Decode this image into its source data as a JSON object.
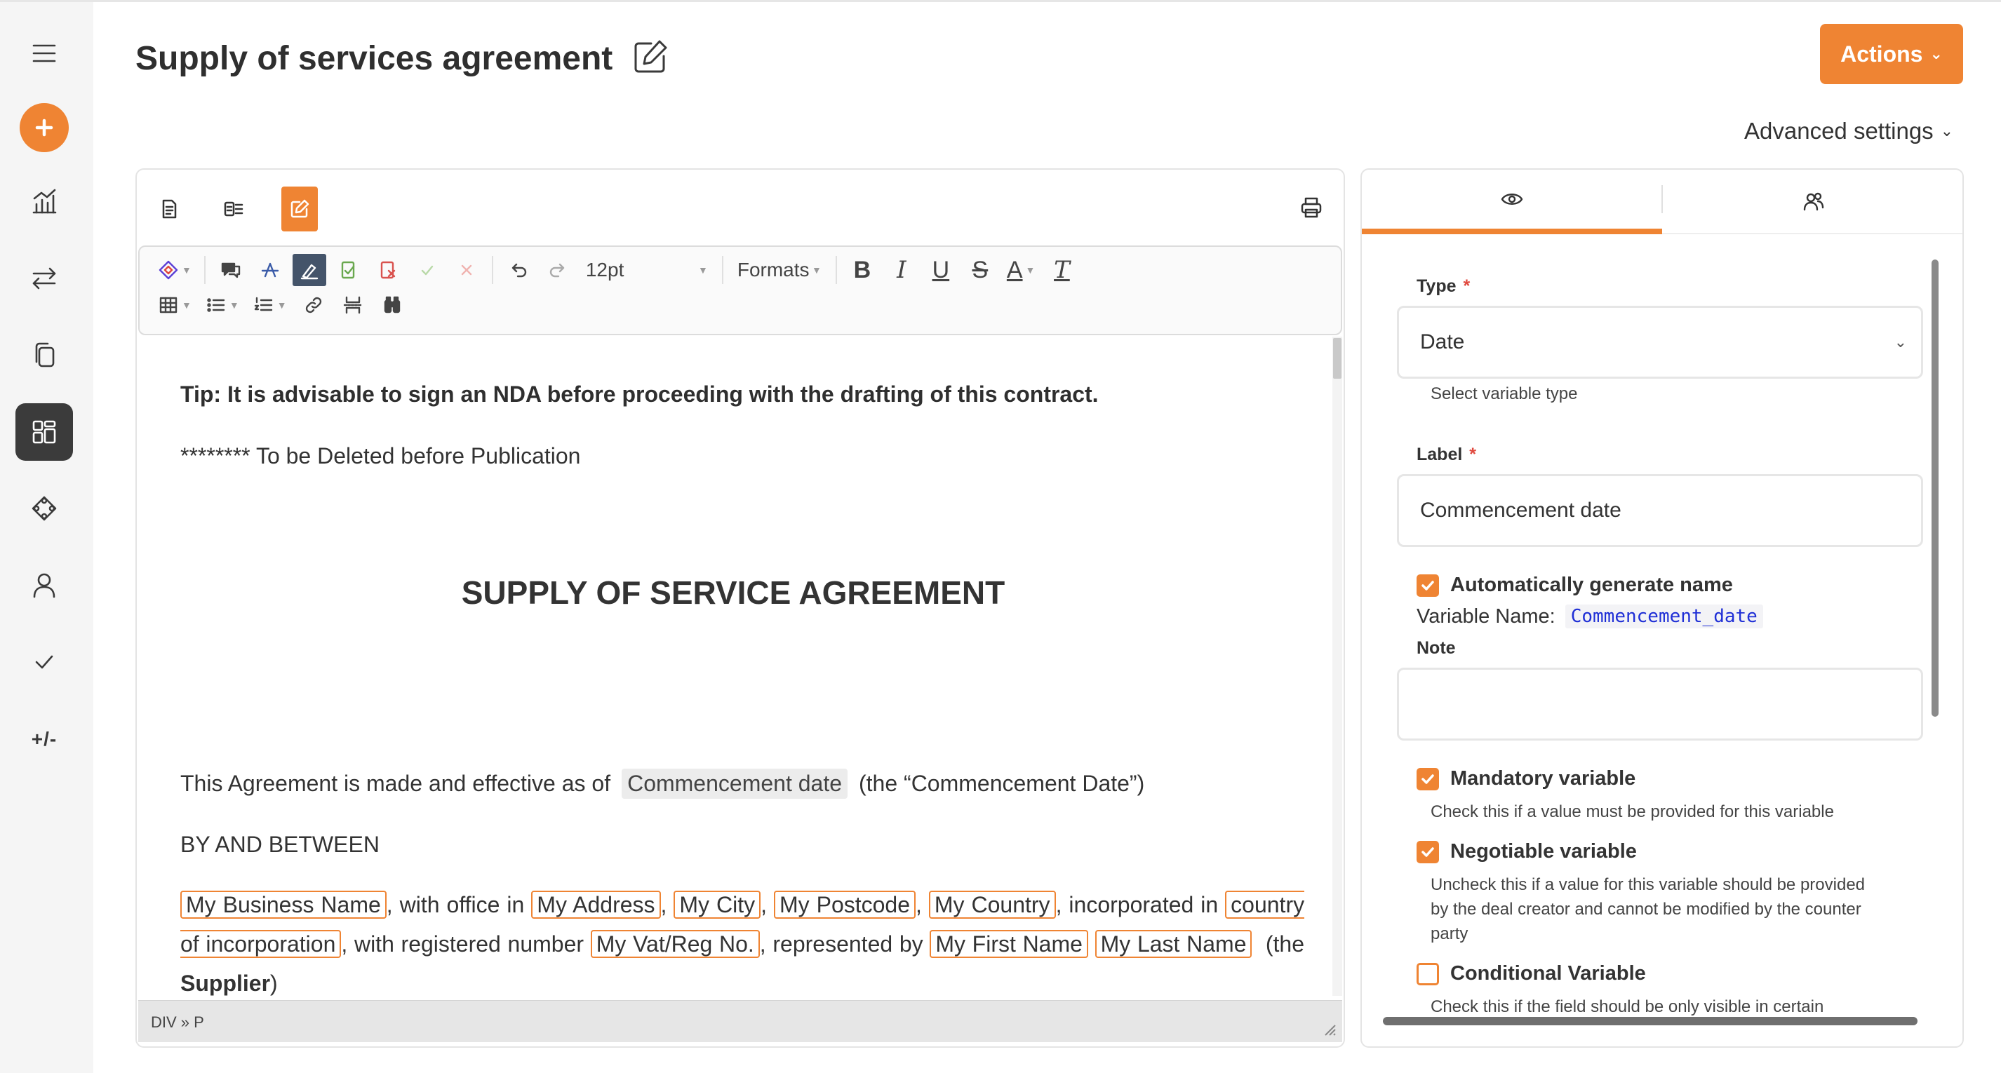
{
  "page": {
    "title": "Supply of services agreement",
    "actions_label": "Actions",
    "advanced_settings_label": "Advanced settings",
    "accent_color": "#ef8433"
  },
  "sidebar": {
    "items": [
      {
        "name": "menu",
        "icon": "menu-icon"
      },
      {
        "name": "create",
        "icon": "plus-icon"
      },
      {
        "name": "analytics",
        "icon": "chart-icon"
      },
      {
        "name": "transfers",
        "icon": "arrows-icon"
      },
      {
        "name": "documents",
        "icon": "copy-icon"
      },
      {
        "name": "templates",
        "icon": "dashboard-icon",
        "active": true
      },
      {
        "name": "integrations",
        "icon": "puzzle-icon"
      },
      {
        "name": "users",
        "icon": "user-icon"
      },
      {
        "name": "approvals",
        "icon": "check-icon"
      },
      {
        "name": "variables",
        "label": "+/-"
      }
    ]
  },
  "editor": {
    "font_size": "12pt",
    "formats_label": "Formats",
    "status_path": "DIV » P",
    "document": {
      "tip": "Tip: It is advisable to sign an NDA before proceeding with the drafting of this contract.",
      "delete_note": "******** To be Deleted before Publication",
      "heading": "SUPPLY OF SERVICE AGREEMENT",
      "intro_prefix": "This  Agreement is made and effective as of",
      "intro_variable": "Commencement date",
      "intro_suffix": "(the “Commencement Date”)",
      "by_and_between": "BY AND BETWEEN",
      "parties": {
        "business_name": "My Business Name",
        "t_with_office": "with office in",
        "address": "My Address",
        "city": "My City",
        "postcode": "My Postcode",
        "country": "My Country",
        "t_incorporated": "incorporated in",
        "country_inc": "country of incorporation",
        "t_registered": "with registered number",
        "vat": "My Vat/Reg No.",
        "t_represented": "represented by",
        "first_name": "My First Name",
        "last_name": "My Last Name",
        "t_the": "(the",
        "supplier": "Supplier",
        "t_close": ")"
      }
    }
  },
  "variable_panel": {
    "type_label": "Type",
    "type_value": "Date",
    "type_help": "Select variable type",
    "label_label": "Label",
    "label_value": "Commencement date",
    "auto_name_label": "Automatically generate name",
    "auto_name_checked": true,
    "variable_name_prefix": "Variable Name:",
    "variable_name": "Commencement_date",
    "note_label": "Note",
    "note_value": "",
    "mandatory_label": "Mandatory variable",
    "mandatory_checked": true,
    "mandatory_help": "Check this if a value must be provided for this variable",
    "negotiable_label": "Negotiable variable",
    "negotiable_checked": true,
    "negotiable_help_1": "Uncheck this if a value for this variable should be provided",
    "negotiable_help_2": "by the deal creator and cannot be modified by the counter",
    "negotiable_help_3": "party",
    "conditional_label": "Conditional Variable",
    "conditional_checked": false,
    "conditional_help": "Check this if the field should be only visible in certain"
  }
}
